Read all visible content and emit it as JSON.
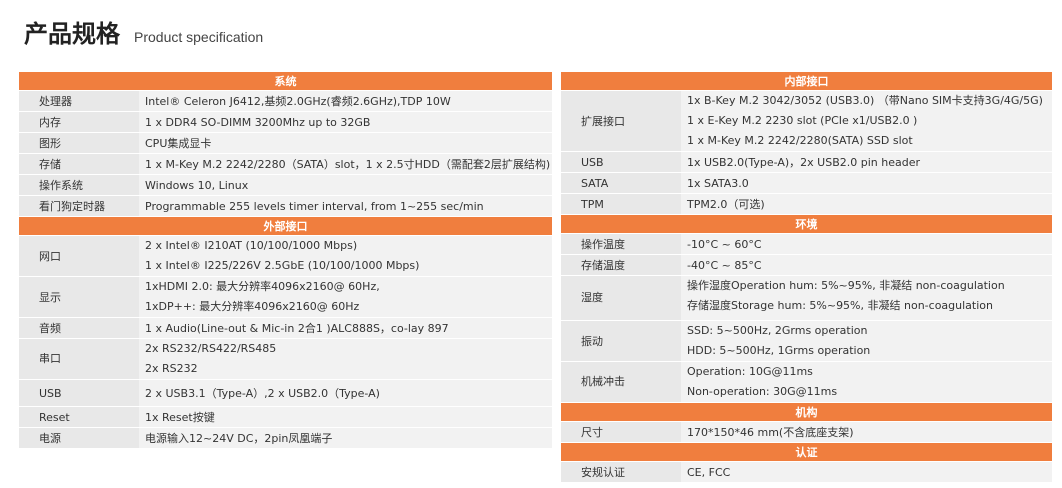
{
  "header": {
    "title": "产品规格",
    "subtitle": "Product specification"
  },
  "left": {
    "system": {
      "title": "系统",
      "rows": [
        {
          "label": "处理器",
          "value": "Intel® Celeron J6412,基频2.0GHz(睿频2.6GHz),TDP 10W"
        },
        {
          "label": "内存",
          "value": "1 x DDR4 SO-DIMM 3200Mhz up to 32GB"
        },
        {
          "label": "图形",
          "value": "CPU集成显卡"
        },
        {
          "label": "存储",
          "value": "1 x M-Key M.2 2242/2280（SATA）slot，1 x 2.5寸HDD（需配套2层扩展结构)"
        },
        {
          "label": "操作系统",
          "value": "Windows 10, Linux"
        },
        {
          "label": "看门狗定时器",
          "value": "Programmable 255 levels timer interval, from 1~255 sec/min"
        }
      ]
    },
    "external": {
      "title": "外部接口",
      "network": {
        "label": "网口",
        "lines": [
          "2 x Intel®  I210AT (10/100/1000 Mbps)",
          "1 x Intel®  I225/226V 2.5GbE (10/100/1000 Mbps)"
        ]
      },
      "display": {
        "label": "显示",
        "lines": [
          "1xHDMI 2.0:  最大分辨率4096x2160@ 60Hz,",
          "1xDP++:  最大分辨率4096x2160@ 60Hz"
        ]
      },
      "audio": {
        "label": "音频",
        "value": "1 x Audio(Line-out & Mic-in 2合1 )ALC888S，co-lay 897"
      },
      "serial": {
        "label": "串口",
        "lines": [
          "2x  RS232/RS422/RS485",
          "2x  RS232"
        ]
      },
      "usb": {
        "label": "USB",
        "value": "2 x USB3.1（Type-A）,2 x USB2.0（Type-A)"
      },
      "reset": {
        "label": "Reset",
        "value": "1x Reset按键"
      },
      "power": {
        "label": "电源",
        "value": "电源输入12~24V DC，2pin凤凰端子"
      }
    }
  },
  "right": {
    "internal": {
      "title": "内部接口",
      "expansion": {
        "label": "扩展接口",
        "lines": [
          "1x B-Key M.2 3042/3052 (USB3.0)  （带Nano SIM卡支持3G/4G/5G)",
          "1 x E-Key M.2 2230 slot (PCIe x1/USB2.0 )",
          "1 x M-Key M.2 2242/2280(SATA) SSD slot"
        ]
      },
      "usb": {
        "label": "USB",
        "value": "1x USB2.0(Type-A)，2x USB2.0 pin header"
      },
      "sata": {
        "label": "SATA",
        "value": "1x SATA3.0"
      },
      "tpm": {
        "label": "TPM",
        "value": "TPM2.0（可选)"
      }
    },
    "environment": {
      "title": "环境",
      "op_temp": {
        "label": "操作温度",
        "value": "-10°C ~ 60°C"
      },
      "st_temp": {
        "label": "存储温度",
        "value": "-40°C ~ 85°C"
      },
      "humidity": {
        "label": "湿度",
        "lines": [
          "操作湿度Operation hum: 5%~95%, 非凝结 non-coagulation",
          "存储湿度Storage hum: 5%~95%, 非凝结 non-coagulation"
        ]
      },
      "vibration": {
        "label": "振动",
        "lines": [
          "SSD: 5~500Hz, 2Grms operation",
          "HDD: 5~500Hz, 1Grms operation"
        ]
      },
      "shock": {
        "label": "机械冲击",
        "lines": [
          "Operation: 10G@11ms",
          "Non-operation: 30G@11ms"
        ]
      }
    },
    "mechanical": {
      "title": "机构",
      "size": {
        "label": "尺寸",
        "value": "170*150*46 mm(不含底座支架)"
      }
    },
    "certification": {
      "title": "认证",
      "safety": {
        "label": "安规认证",
        "value": "CE, FCC"
      }
    }
  }
}
